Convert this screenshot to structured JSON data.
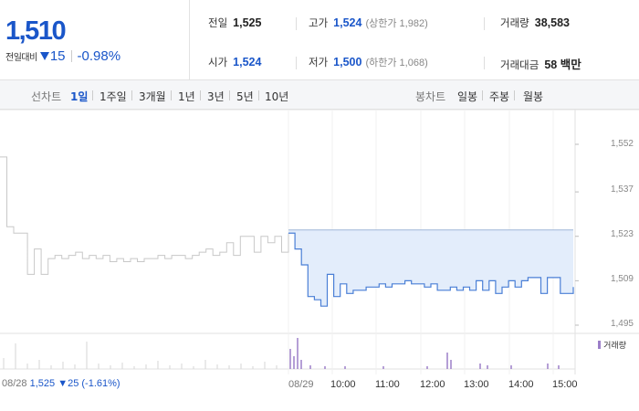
{
  "quote": {
    "price": "1,510",
    "change_label": "전일대비",
    "change_amount": "15",
    "change_percent": "-0.98%",
    "colors": {
      "down": "#1a56c9"
    }
  },
  "stats": {
    "prev_close_label": "전일",
    "prev_close": "1,525",
    "high_label": "고가",
    "high": "1,524",
    "upper_limit_label": "(상한가",
    "upper_limit": "1,982)",
    "volume_label": "거래량",
    "volume": "38,583",
    "open_label": "시가",
    "open": "1,524",
    "low_label": "저가",
    "low": "1,500",
    "lower_limit_label": "(하한가",
    "lower_limit": "1,068)",
    "amount_label": "거래대금",
    "amount": "58 백만"
  },
  "period_bar": {
    "line_label": "선차트",
    "periods": [
      "1일",
      "1주일",
      "3개월",
      "1년",
      "3년",
      "5년",
      "10년"
    ],
    "active": "1일",
    "candle_label": "봉차트",
    "candles": [
      "일봉",
      "주봉",
      "월봉"
    ]
  },
  "chart_data": {
    "type": "line",
    "y_ticks": [
      "1,552",
      "1,537",
      "1,523",
      "1,509",
      "1,495"
    ],
    "ylim": [
      1495,
      1552
    ],
    "reference_price": 1525,
    "legend": "거래량",
    "prev_day": {
      "date": "08/28",
      "close": "1,525",
      "change": "▼25",
      "change_pct": "(-1.61%)"
    },
    "x_ticks": [
      "08/29",
      "10:00",
      "11:00",
      "12:00",
      "13:00",
      "14:00",
      "15:00"
    ],
    "prev_series": [
      1548,
      1526,
      1524,
      1524,
      1511,
      1519,
      1511,
      1516,
      1517,
      1516,
      1517,
      1518,
      1516,
      1517,
      1516,
      1517,
      1515,
      1516,
      1515,
      1516,
      1515,
      1516,
      1516,
      1517,
      1516,
      1517,
      1517,
      1516,
      1517,
      1518,
      1519,
      1517,
      1518,
      1521,
      1517,
      1523,
      1523,
      1518,
      1523,
      1521,
      1523,
      1518,
      1524
    ],
    "today_series": [
      1524,
      1519,
      1514,
      1504,
      1503,
      1501,
      1511,
      1504,
      1508,
      1505,
      1506,
      1506,
      1507,
      1507,
      1508,
      1507,
      1508,
      1508,
      1509,
      1508,
      1508,
      1507,
      1508,
      1506,
      1506,
      1507,
      1506,
      1507,
      1506,
      1509,
      1506,
      1509,
      1505,
      1507,
      1509,
      1507,
      1509,
      1510,
      1510,
      1505,
      1510,
      1510,
      1505,
      1505,
      1507
    ],
    "colors": {
      "today_line": "#4a7fd6",
      "today_fill": "#e3edfb",
      "prev_line": "#c8c8c8",
      "volume": "#9c7fc9"
    }
  }
}
